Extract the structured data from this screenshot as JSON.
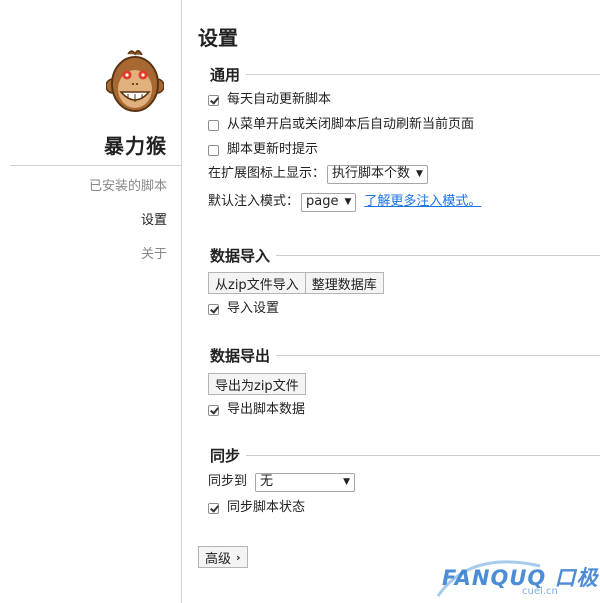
{
  "sidebar": {
    "app_name": "暴力猴",
    "nav": {
      "installed": "已安装的脚本",
      "settings": "设置",
      "about": "关于"
    }
  },
  "main": {
    "title": "设置",
    "general": {
      "heading": "通用",
      "auto_update": {
        "label": "每天自动更新脚本",
        "checked": true
      },
      "auto_reload": {
        "label": "从菜单开启或关闭脚本后自动刷新当前页面",
        "checked": false
      },
      "notify_update": {
        "label": "脚本更新时提示",
        "checked": false
      },
      "badge": {
        "label": "在扩展图标上显示：",
        "value": "执行脚本个数"
      },
      "inject": {
        "label": "默认注入模式：",
        "value": "page",
        "link": "了解更多注入模式。"
      }
    },
    "import": {
      "heading": "数据导入",
      "btn_zip": "从zip文件导入",
      "btn_vacuum": "整理数据库",
      "import_settings": {
        "label": "导入设置",
        "checked": true
      }
    },
    "export": {
      "heading": "数据导出",
      "btn_export": "导出为zip文件",
      "export_data": {
        "label": "导出脚本数据",
        "checked": true
      }
    },
    "sync": {
      "heading": "同步",
      "sync_to_label": "同步到",
      "sync_to_value": "无",
      "sync_state": {
        "label": "同步脚本状态",
        "checked": true
      }
    },
    "advanced_label": "高级"
  },
  "watermark": {
    "brand": "FANQUQ 口极",
    "domain": "cuel.cn"
  },
  "colors": {
    "link": "#1a73e8",
    "border": "#d4d4d4",
    "monkey_face": "#c98a4e",
    "monkey_eyes": "#e43a2b"
  }
}
